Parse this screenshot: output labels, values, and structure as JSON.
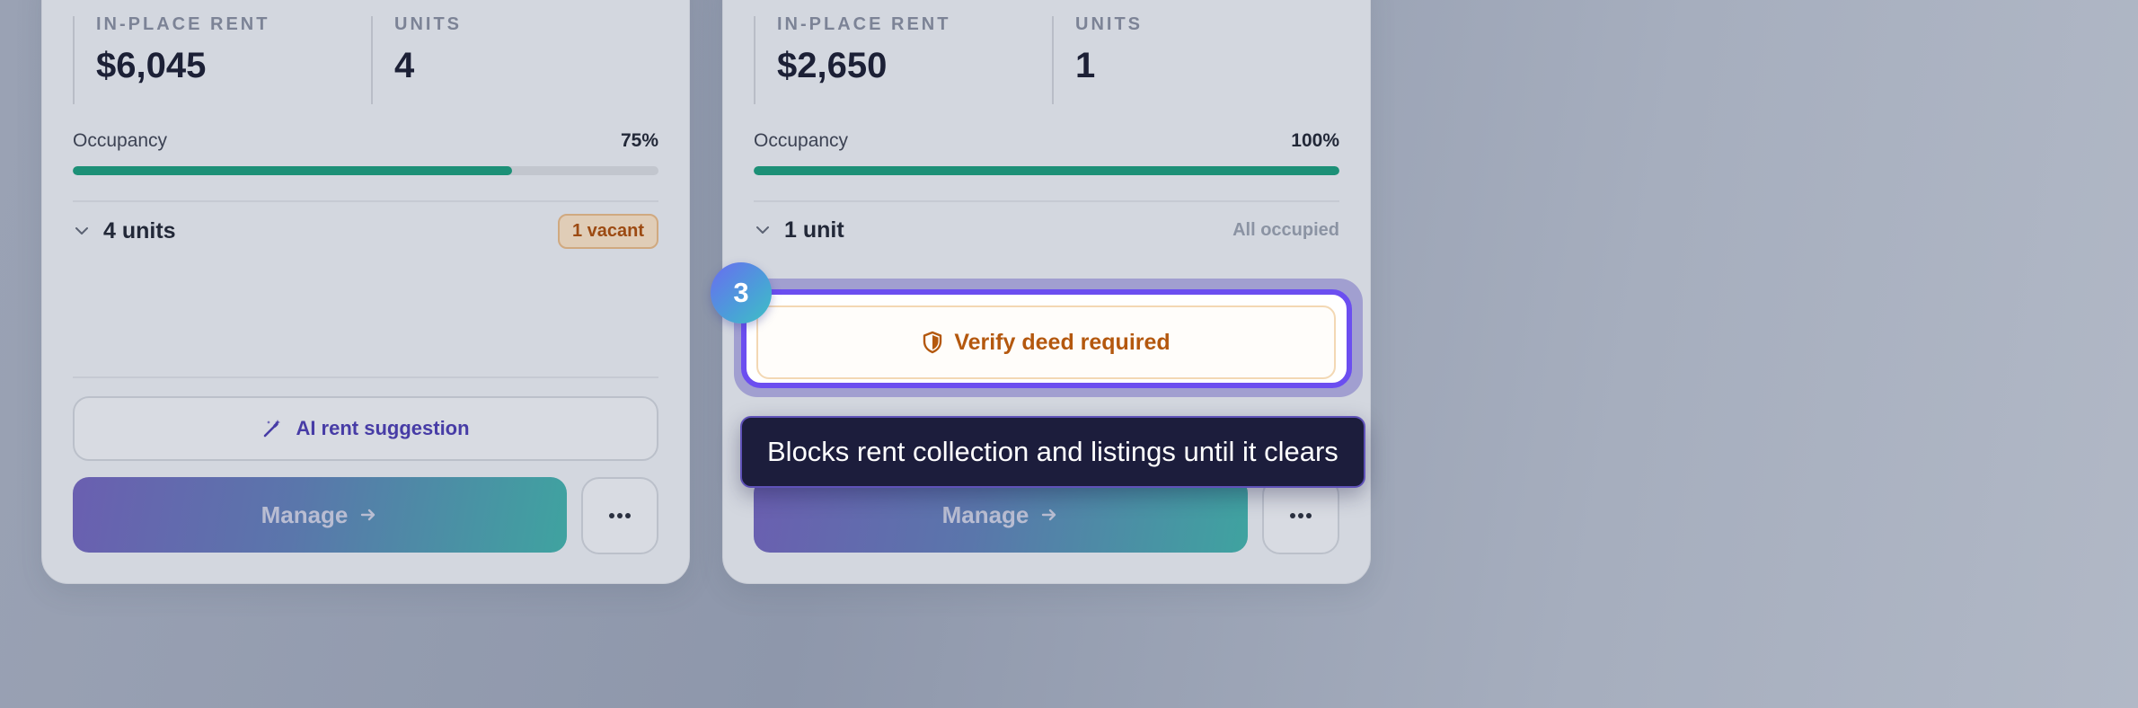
{
  "cards": [
    {
      "rent_label": "IN-PLACE RENT",
      "rent_value": "$6,045",
      "units_label": "UNITS",
      "units_value": "4",
      "occupancy_label": "Occupancy",
      "occupancy_pct": "75%",
      "occupancy_fraction": 0.75,
      "units_summary": "4 units",
      "vacancy_badge": "1 vacant",
      "ai_button_label": "AI rent suggestion",
      "manage_label": "Manage"
    },
    {
      "rent_label": "IN-PLACE RENT",
      "rent_value": "$2,650",
      "units_label": "UNITS",
      "units_value": "1",
      "occupancy_label": "Occupancy",
      "occupancy_pct": "100%",
      "occupancy_fraction": 1.0,
      "units_summary": "1 unit",
      "occupancy_status": "All occupied",
      "manage_label": "Manage"
    }
  ],
  "highlight": {
    "step_number": "3",
    "verify_label": "Verify deed required",
    "tooltip": "Blocks rent collection and listings until it clears"
  },
  "icons": {
    "chevron": "chevron-down-icon",
    "wand": "magic-wand-icon",
    "arrow": "arrow-right-icon",
    "more": "more-horizontal-icon",
    "shield": "shield-icon"
  },
  "colors": {
    "occupancy_bar": "#1c9077",
    "accent_purple": "#6b4ef0",
    "warning_text": "#b4580e",
    "ai_button_text": "#473ca6"
  }
}
